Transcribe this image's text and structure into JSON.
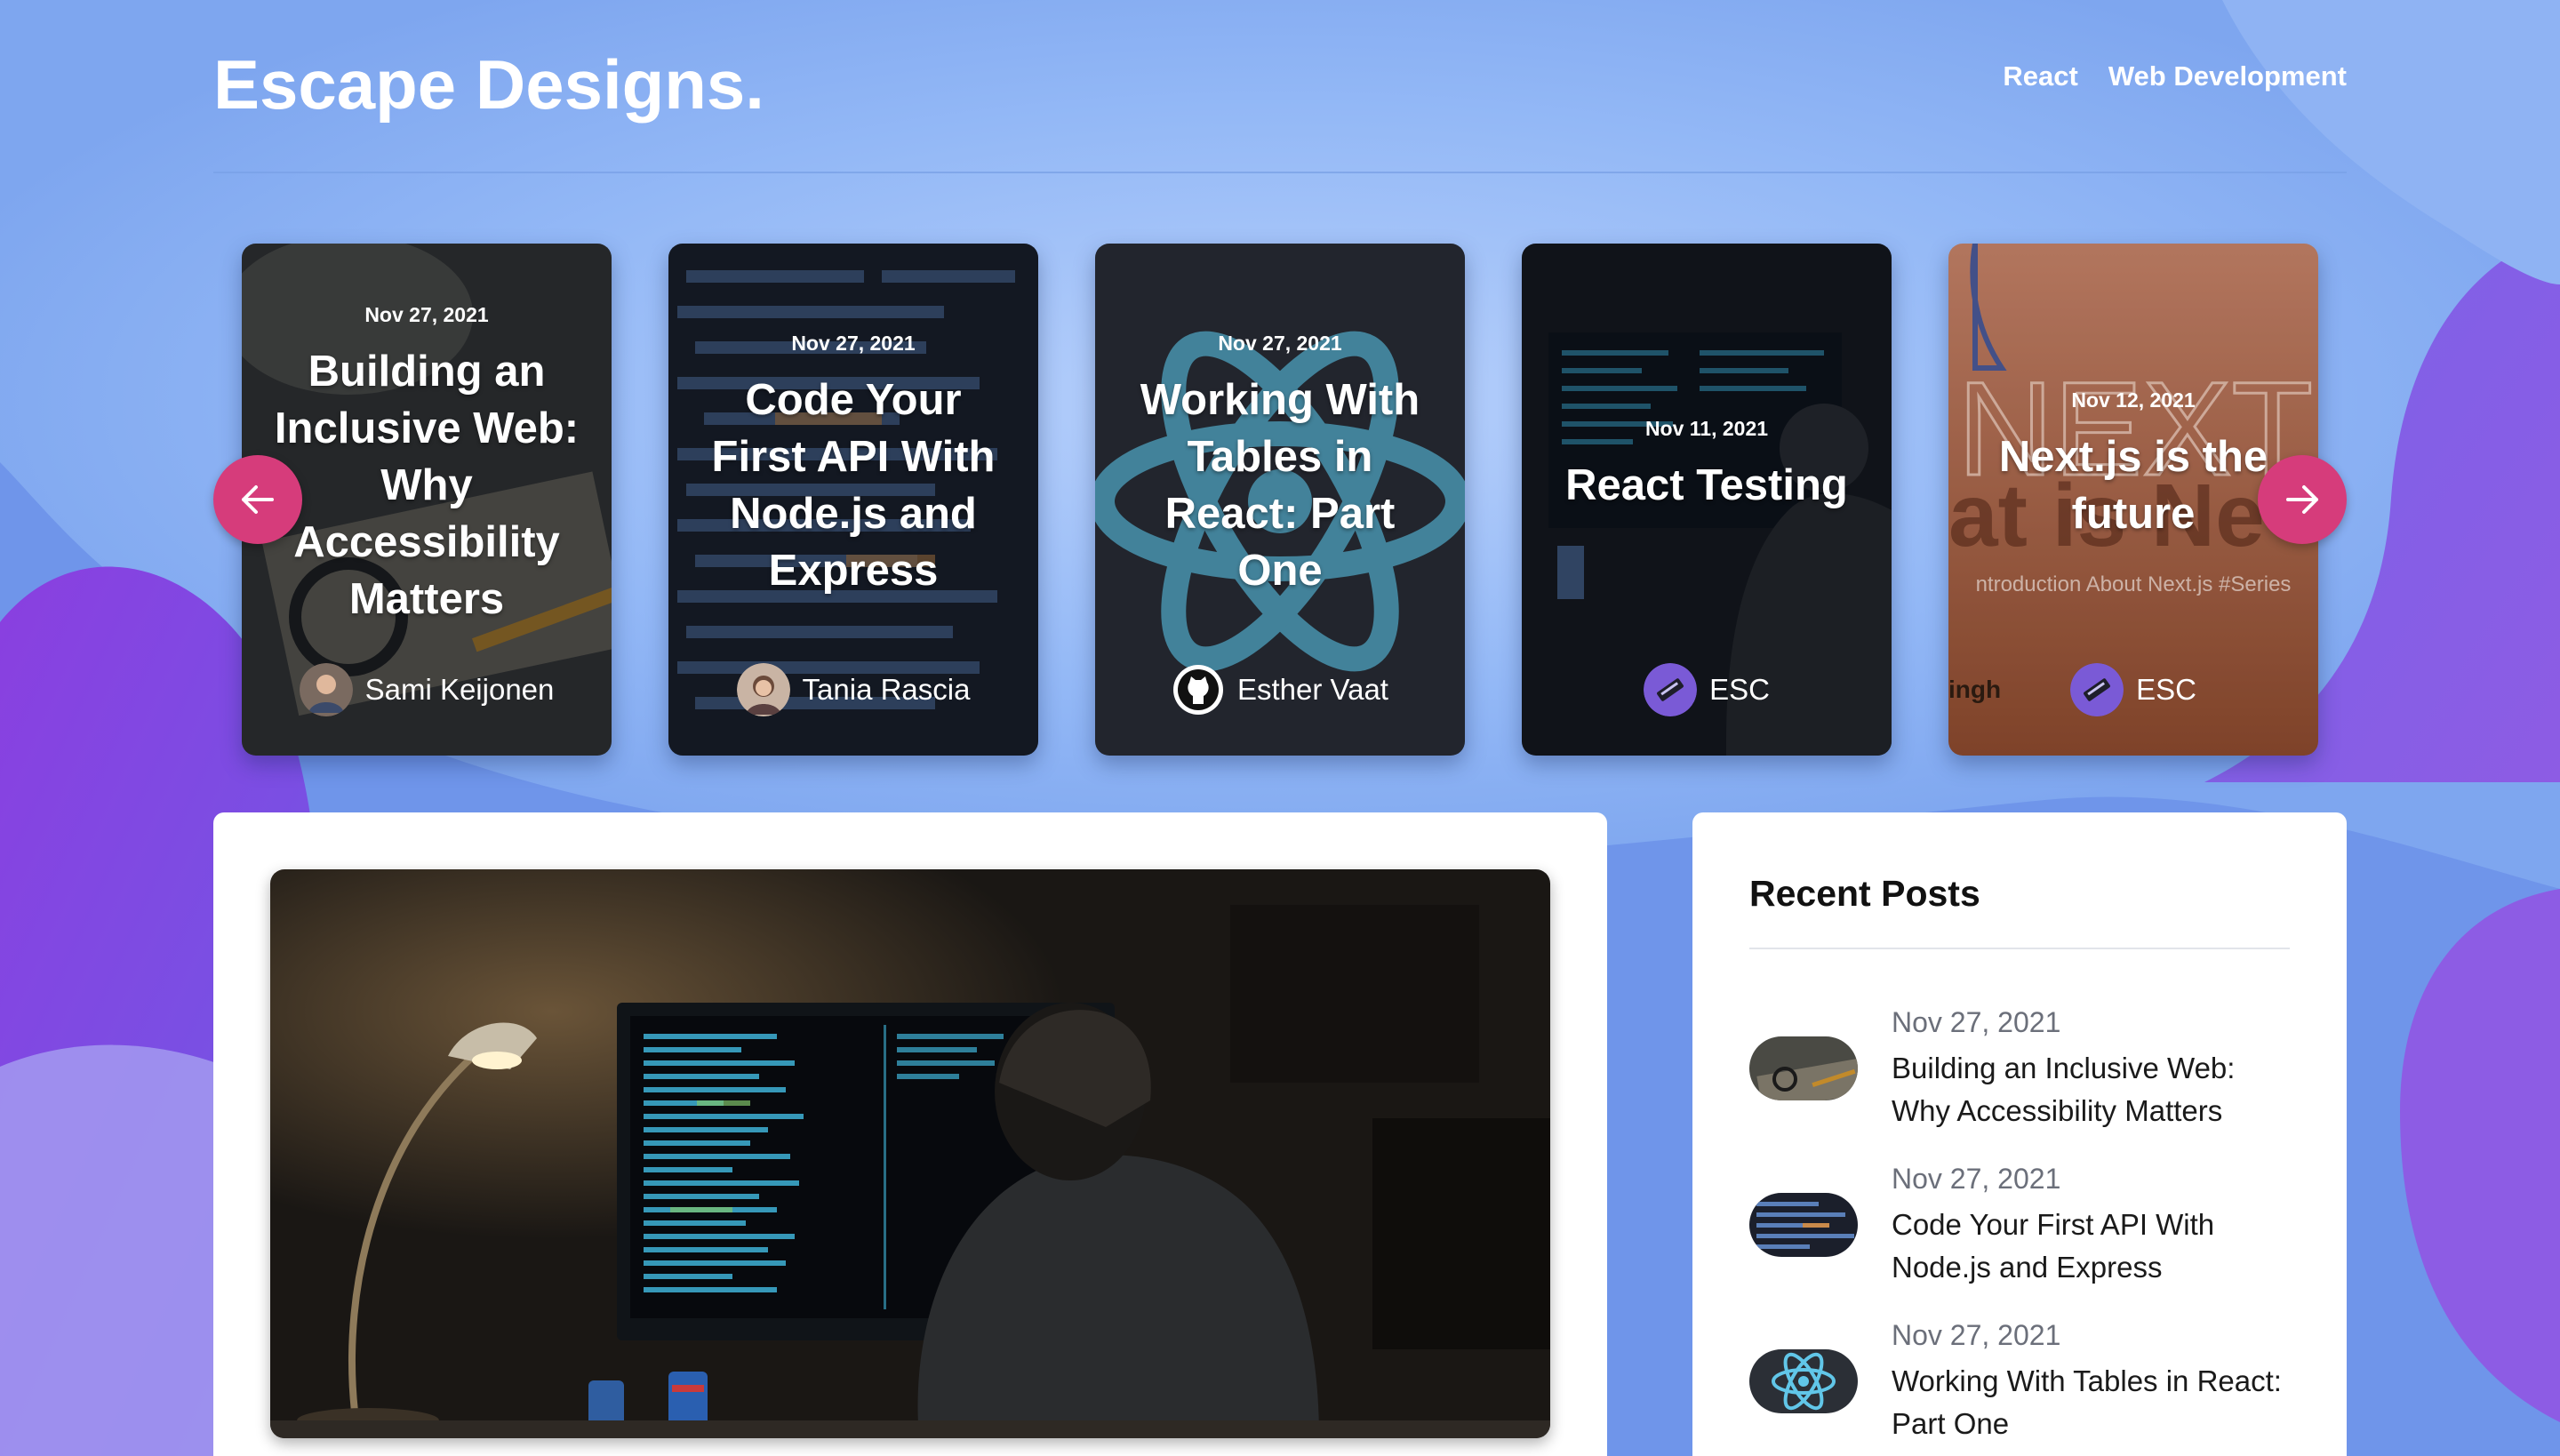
{
  "site": {
    "logo": "Escape Designs.",
    "nav": [
      {
        "label": "React"
      },
      {
        "label": "Web Development"
      }
    ]
  },
  "carousel": {
    "cards": [
      {
        "date": "Nov 27, 2021",
        "title": "Building an Inclusive Web: Why Accessibility Matters",
        "author": "Sami Keijonen"
      },
      {
        "date": "Nov 27, 2021",
        "title": "Code Your First API With Node.js and Express",
        "author": "Tania Rascia"
      },
      {
        "date": "Nov 27, 2021",
        "title": "Working With Tables in React: Part One",
        "author": "Esther Vaat"
      },
      {
        "date": "Nov 11, 2021",
        "title": "React Testing",
        "author": "ESC"
      },
      {
        "date": "Nov 12, 2021",
        "title": "Next.js is the future",
        "author": "ESC",
        "bg_text": "ntroduction About Next.js #Series",
        "partial_author": "ingh"
      }
    ],
    "prev_icon": "arrow-left-icon",
    "next_icon": "arrow-right-icon",
    "arrow_color": "#d63c7b"
  },
  "sidebar": {
    "title": "Recent Posts",
    "items": [
      {
        "date": "Nov 27, 2021",
        "title": "Building an Inclusive Web: Why Accessibility Matters"
      },
      {
        "date": "Nov 27, 2021",
        "title": "Code Your First API With Node.js and Express"
      },
      {
        "date": "Nov 27, 2021",
        "title": "Working With Tables in React: Part One"
      }
    ]
  },
  "colors": {
    "background": "#7ea6ef",
    "blob_purple": "#7a4fe0",
    "panel": "#ffffff",
    "accent": "#d63c7b"
  }
}
